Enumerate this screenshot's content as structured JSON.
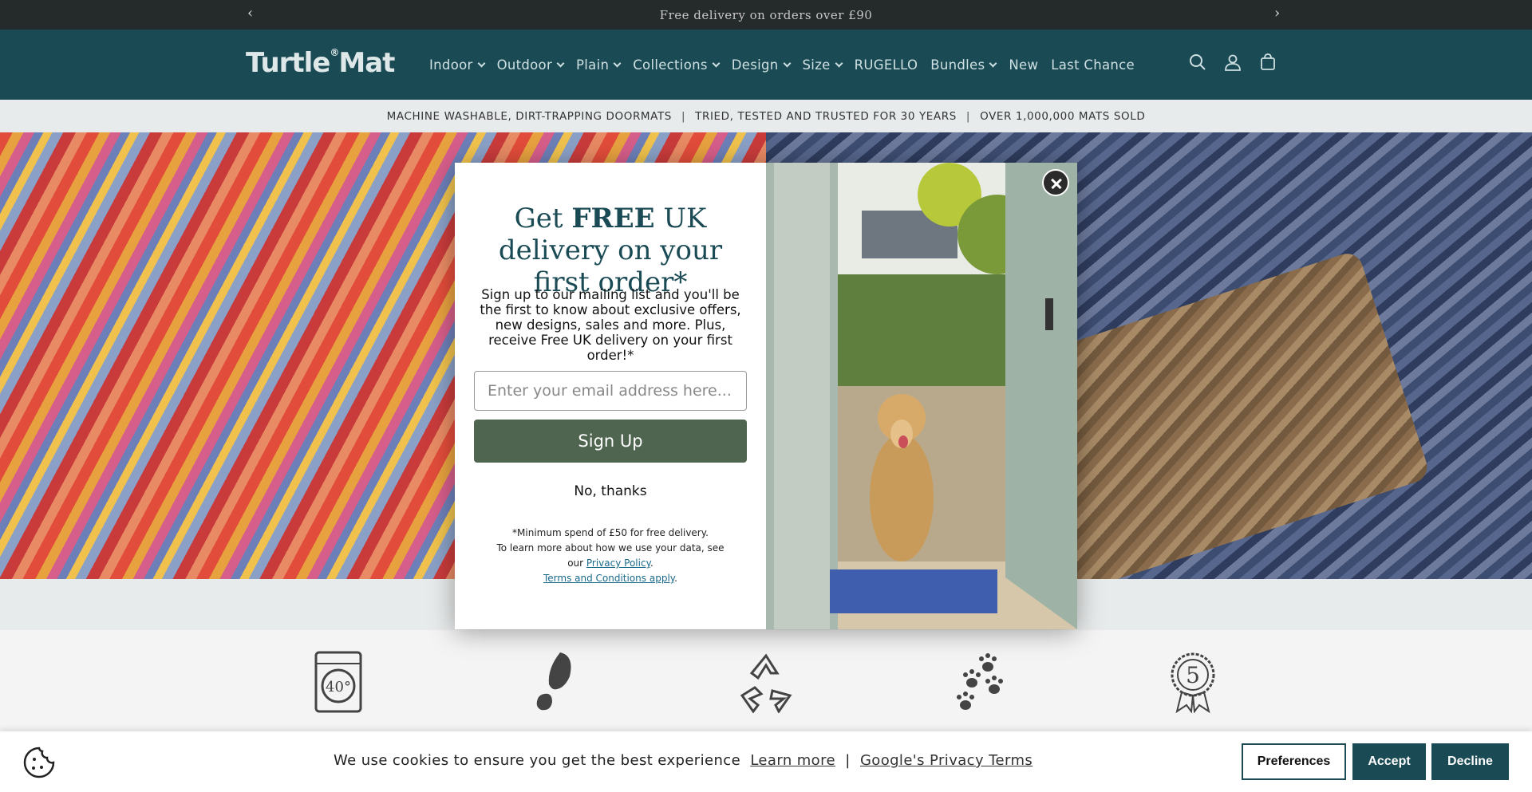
{
  "announcement": {
    "text": "Free delivery on orders over £90",
    "prev": "‹",
    "next": "›"
  },
  "header": {
    "logo_text": "Turtle",
    "logo_text2": "Mat",
    "logo_mark": "®",
    "nav": [
      {
        "label": "Indoor",
        "dropdown": true
      },
      {
        "label": "Outdoor",
        "dropdown": true
      },
      {
        "label": "Plain",
        "dropdown": true
      },
      {
        "label": "Collections",
        "dropdown": true
      },
      {
        "label": "Design",
        "dropdown": true
      },
      {
        "label": "Size",
        "dropdown": true
      },
      {
        "label": "RUGELLO",
        "dropdown": false
      },
      {
        "label": "Bundles",
        "dropdown": true
      },
      {
        "label": "New",
        "dropdown": false
      },
      {
        "label": "Last Chance",
        "dropdown": false
      }
    ],
    "icons": [
      "search-icon",
      "account-icon",
      "cart-icon"
    ]
  },
  "usp": {
    "items": [
      "MACHINE WASHABLE, DIRT-TRAPPING DOORMATS",
      "TRIED, TESTED AND TRUSTED FOR 30 YEARS",
      "OVER 1,000,000 MATS SOLD"
    ],
    "separator": "|"
  },
  "features": {
    "icons": [
      "washing-machine-40-icon",
      "boot-print-icon",
      "recycle-icon",
      "paw-prints-icon",
      "award-5-icon"
    ],
    "washing_label": "40°",
    "award_label": "5"
  },
  "popup": {
    "heading_1": "Get ",
    "heading_bold": "FREE",
    "heading_2": " UK delivery on your first order*",
    "description": "Sign up to our mailing list and you'll be the first to know about exclusive offers, new designs, sales and more. Plus, receive Free UK delivery on your first order!*",
    "email_placeholder": "Enter your email address here...",
    "signup_label": "Sign Up",
    "no_thanks_label": "No, thanks",
    "fine_1": "*Minimum spend of £50 for free delivery.",
    "fine_2": "To learn more about how we use your data, see our ",
    "privacy_link": "Privacy Policy",
    "fine_3": ".",
    "terms_link": "Terms and Conditions apply",
    "fine_4": "."
  },
  "cookie": {
    "message": "We use cookies to ensure you get the best experience",
    "learn_more": "Learn more",
    "divider": "|",
    "privacy_terms": "Google's Privacy Terms",
    "preferences": "Preferences",
    "accept": "Accept",
    "decline": "Decline"
  },
  "colors": {
    "header_bg": "#1a4a54",
    "signup_bg": "#4f6550",
    "cookie_button_bg": "#1a4a54"
  }
}
